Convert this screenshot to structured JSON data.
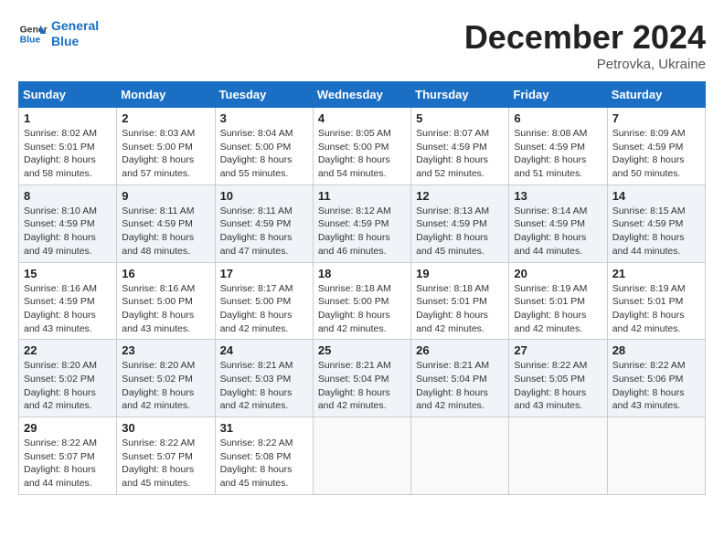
{
  "header": {
    "logo_line1": "General",
    "logo_line2": "Blue",
    "month": "December 2024",
    "location": "Petrovka, Ukraine"
  },
  "weekdays": [
    "Sunday",
    "Monday",
    "Tuesday",
    "Wednesday",
    "Thursday",
    "Friday",
    "Saturday"
  ],
  "weeks": [
    [
      {
        "day": "1",
        "sunrise": "8:02 AM",
        "sunset": "5:01 PM",
        "daylight": "8 hours and 58 minutes."
      },
      {
        "day": "2",
        "sunrise": "8:03 AM",
        "sunset": "5:00 PM",
        "daylight": "8 hours and 57 minutes."
      },
      {
        "day": "3",
        "sunrise": "8:04 AM",
        "sunset": "5:00 PM",
        "daylight": "8 hours and 55 minutes."
      },
      {
        "day": "4",
        "sunrise": "8:05 AM",
        "sunset": "5:00 PM",
        "daylight": "8 hours and 54 minutes."
      },
      {
        "day": "5",
        "sunrise": "8:07 AM",
        "sunset": "4:59 PM",
        "daylight": "8 hours and 52 minutes."
      },
      {
        "day": "6",
        "sunrise": "8:08 AM",
        "sunset": "4:59 PM",
        "daylight": "8 hours and 51 minutes."
      },
      {
        "day": "7",
        "sunrise": "8:09 AM",
        "sunset": "4:59 PM",
        "daylight": "8 hours and 50 minutes."
      }
    ],
    [
      {
        "day": "8",
        "sunrise": "8:10 AM",
        "sunset": "4:59 PM",
        "daylight": "8 hours and 49 minutes."
      },
      {
        "day": "9",
        "sunrise": "8:11 AM",
        "sunset": "4:59 PM",
        "daylight": "8 hours and 48 minutes."
      },
      {
        "day": "10",
        "sunrise": "8:11 AM",
        "sunset": "4:59 PM",
        "daylight": "8 hours and 47 minutes."
      },
      {
        "day": "11",
        "sunrise": "8:12 AM",
        "sunset": "4:59 PM",
        "daylight": "8 hours and 46 minutes."
      },
      {
        "day": "12",
        "sunrise": "8:13 AM",
        "sunset": "4:59 PM",
        "daylight": "8 hours and 45 minutes."
      },
      {
        "day": "13",
        "sunrise": "8:14 AM",
        "sunset": "4:59 PM",
        "daylight": "8 hours and 44 minutes."
      },
      {
        "day": "14",
        "sunrise": "8:15 AM",
        "sunset": "4:59 PM",
        "daylight": "8 hours and 44 minutes."
      }
    ],
    [
      {
        "day": "15",
        "sunrise": "8:16 AM",
        "sunset": "4:59 PM",
        "daylight": "8 hours and 43 minutes."
      },
      {
        "day": "16",
        "sunrise": "8:16 AM",
        "sunset": "5:00 PM",
        "daylight": "8 hours and 43 minutes."
      },
      {
        "day": "17",
        "sunrise": "8:17 AM",
        "sunset": "5:00 PM",
        "daylight": "8 hours and 42 minutes."
      },
      {
        "day": "18",
        "sunrise": "8:18 AM",
        "sunset": "5:00 PM",
        "daylight": "8 hours and 42 minutes."
      },
      {
        "day": "19",
        "sunrise": "8:18 AM",
        "sunset": "5:01 PM",
        "daylight": "8 hours and 42 minutes."
      },
      {
        "day": "20",
        "sunrise": "8:19 AM",
        "sunset": "5:01 PM",
        "daylight": "8 hours and 42 minutes."
      },
      {
        "day": "21",
        "sunrise": "8:19 AM",
        "sunset": "5:01 PM",
        "daylight": "8 hours and 42 minutes."
      }
    ],
    [
      {
        "day": "22",
        "sunrise": "8:20 AM",
        "sunset": "5:02 PM",
        "daylight": "8 hours and 42 minutes."
      },
      {
        "day": "23",
        "sunrise": "8:20 AM",
        "sunset": "5:02 PM",
        "daylight": "8 hours and 42 minutes."
      },
      {
        "day": "24",
        "sunrise": "8:21 AM",
        "sunset": "5:03 PM",
        "daylight": "8 hours and 42 minutes."
      },
      {
        "day": "25",
        "sunrise": "8:21 AM",
        "sunset": "5:04 PM",
        "daylight": "8 hours and 42 minutes."
      },
      {
        "day": "26",
        "sunrise": "8:21 AM",
        "sunset": "5:04 PM",
        "daylight": "8 hours and 42 minutes."
      },
      {
        "day": "27",
        "sunrise": "8:22 AM",
        "sunset": "5:05 PM",
        "daylight": "8 hours and 43 minutes."
      },
      {
        "day": "28",
        "sunrise": "8:22 AM",
        "sunset": "5:06 PM",
        "daylight": "8 hours and 43 minutes."
      }
    ],
    [
      {
        "day": "29",
        "sunrise": "8:22 AM",
        "sunset": "5:07 PM",
        "daylight": "8 hours and 44 minutes."
      },
      {
        "day": "30",
        "sunrise": "8:22 AM",
        "sunset": "5:07 PM",
        "daylight": "8 hours and 45 minutes."
      },
      {
        "day": "31",
        "sunrise": "8:22 AM",
        "sunset": "5:08 PM",
        "daylight": "8 hours and 45 minutes."
      },
      null,
      null,
      null,
      null
    ]
  ],
  "labels": {
    "sunrise": "Sunrise:",
    "sunset": "Sunset:",
    "daylight": "Daylight:"
  }
}
